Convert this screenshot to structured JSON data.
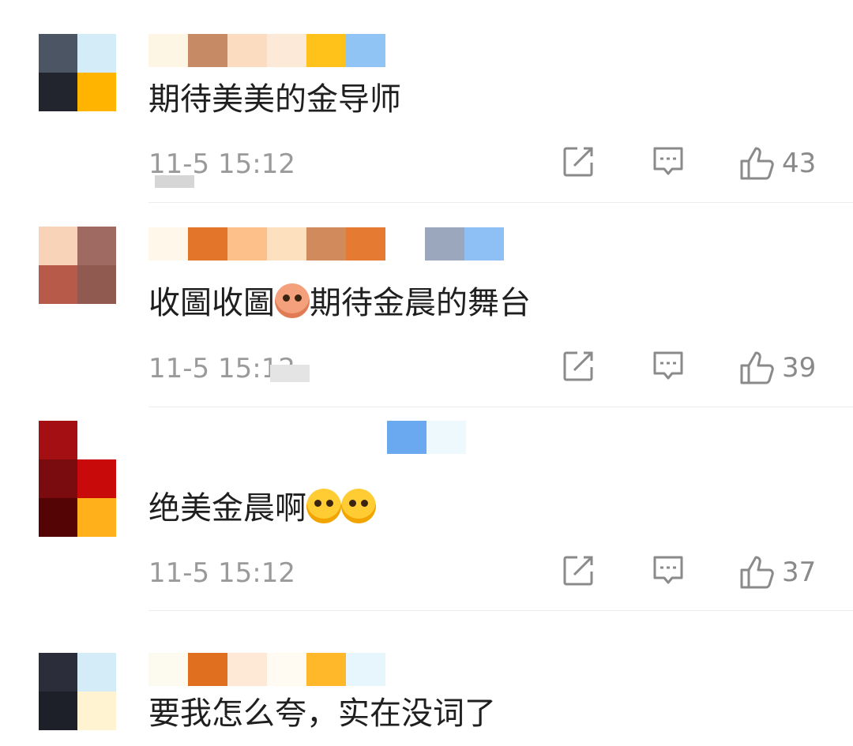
{
  "comments": [
    {
      "text": "期待美美的金导师",
      "time": "11-5 15:12",
      "likes": "43"
    },
    {
      "text_a": "收圖收圖",
      "text_b": "期待金晨的舞台",
      "time": "11-5 15:12",
      "likes": "39"
    },
    {
      "text": "绝美金晨啊",
      "time": "11-5 15:12",
      "likes": "37"
    },
    {
      "text": "要我怎么夸，实在没词了"
    }
  ],
  "icons": {
    "share": "share-icon",
    "reply": "comment-icon",
    "like": "thumbs-up-icon",
    "emoji_1": "pink-face-emoji",
    "emoji_2": "grinning-face-emoji"
  },
  "colors": {
    "text": "#1f1f1f",
    "meta": "#9a9a9a",
    "icon": "#8a8a8a",
    "divider": "#ececec"
  }
}
